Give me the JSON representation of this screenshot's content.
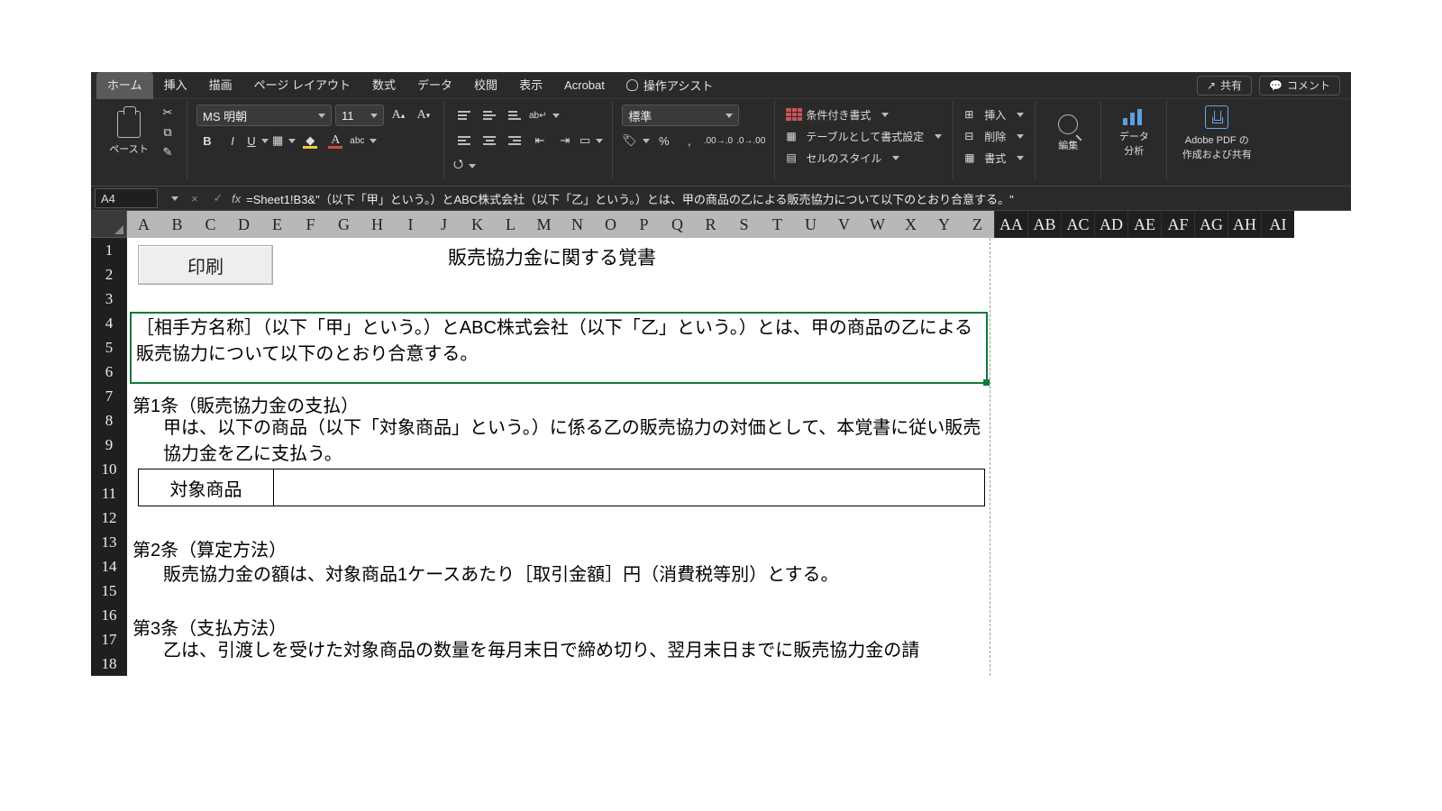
{
  "tabs": {
    "home": "ホーム",
    "insert": "挿入",
    "draw": "描画",
    "layout": "ページ レイアウト",
    "formula": "数式",
    "data": "データ",
    "review": "校閲",
    "view": "表示",
    "acrobat": "Acrobat",
    "tellme": "操作アシスト"
  },
  "actions": {
    "share": "共有",
    "comment": "コメント"
  },
  "ribbon": {
    "paste": "ペースト",
    "font_name": "MS 明朝",
    "font_size": "11",
    "number_format": "標準",
    "cond_fmt": "条件付き書式",
    "table_fmt": "テーブルとして書式設定",
    "cell_style": "セルのスタイル",
    "ins": "挿入",
    "del": "削除",
    "fmt": "書式",
    "edit": "編集",
    "analyze": "データ\n分析",
    "pdf": "Adobe PDF の\n作成および共有",
    "bold": "B",
    "italic": "I",
    "underline": "U"
  },
  "fbar": {
    "cell": "A4",
    "fx": "fx",
    "formula": "=Sheet1!B3&\"（以下「甲」という。）とABC株式会社（以下「乙」という。）とは、甲の商品の乙による販売協力について以下のとおり合意する。\""
  },
  "cols_light": [
    "A",
    "B",
    "C",
    "D",
    "E",
    "F",
    "G",
    "H",
    "I",
    "J",
    "K",
    "L",
    "M",
    "N",
    "O",
    "P",
    "Q",
    "R",
    "S",
    "T",
    "U",
    "V",
    "W",
    "X",
    "Y",
    "Z"
  ],
  "cols_dark": [
    "AA",
    "AB",
    "AC",
    "AD",
    "AE",
    "AF",
    "AG",
    "AH",
    "AI"
  ],
  "rows": [
    "1",
    "2",
    "3",
    "4",
    "5",
    "6",
    "7",
    "8",
    "9",
    "10",
    "11",
    "12",
    "13",
    "14",
    "15",
    "16",
    "17",
    "18"
  ],
  "doc": {
    "title": "販売協力金に関する覚書",
    "print": "印刷",
    "p1": "［相手方名称］（以下「甲」という。）とABC株式会社（以下「乙」という。）とは、甲の商品の乙による販売協力について以下のとおり合意する。",
    "a1_h": "第1条（販売協力金の支払）",
    "a1_b": "甲は、以下の商品（以下「対象商品」という。）に係る乙の販売協力の対価として、本覚書に従い販売協力金を乙に支払う。",
    "tbl_label": "対象商品",
    "a2_h": "第2条（算定方法）",
    "a2_b": "販売協力金の額は、対象商品1ケースあたり［取引金額］円（消費税等別）とする。",
    "a3_h": "第3条（支払方法）",
    "a3_b": "乙は、引渡しを受けた対象商品の数量を毎月末日で締め切り、翌月末日までに販売協力金の請"
  }
}
